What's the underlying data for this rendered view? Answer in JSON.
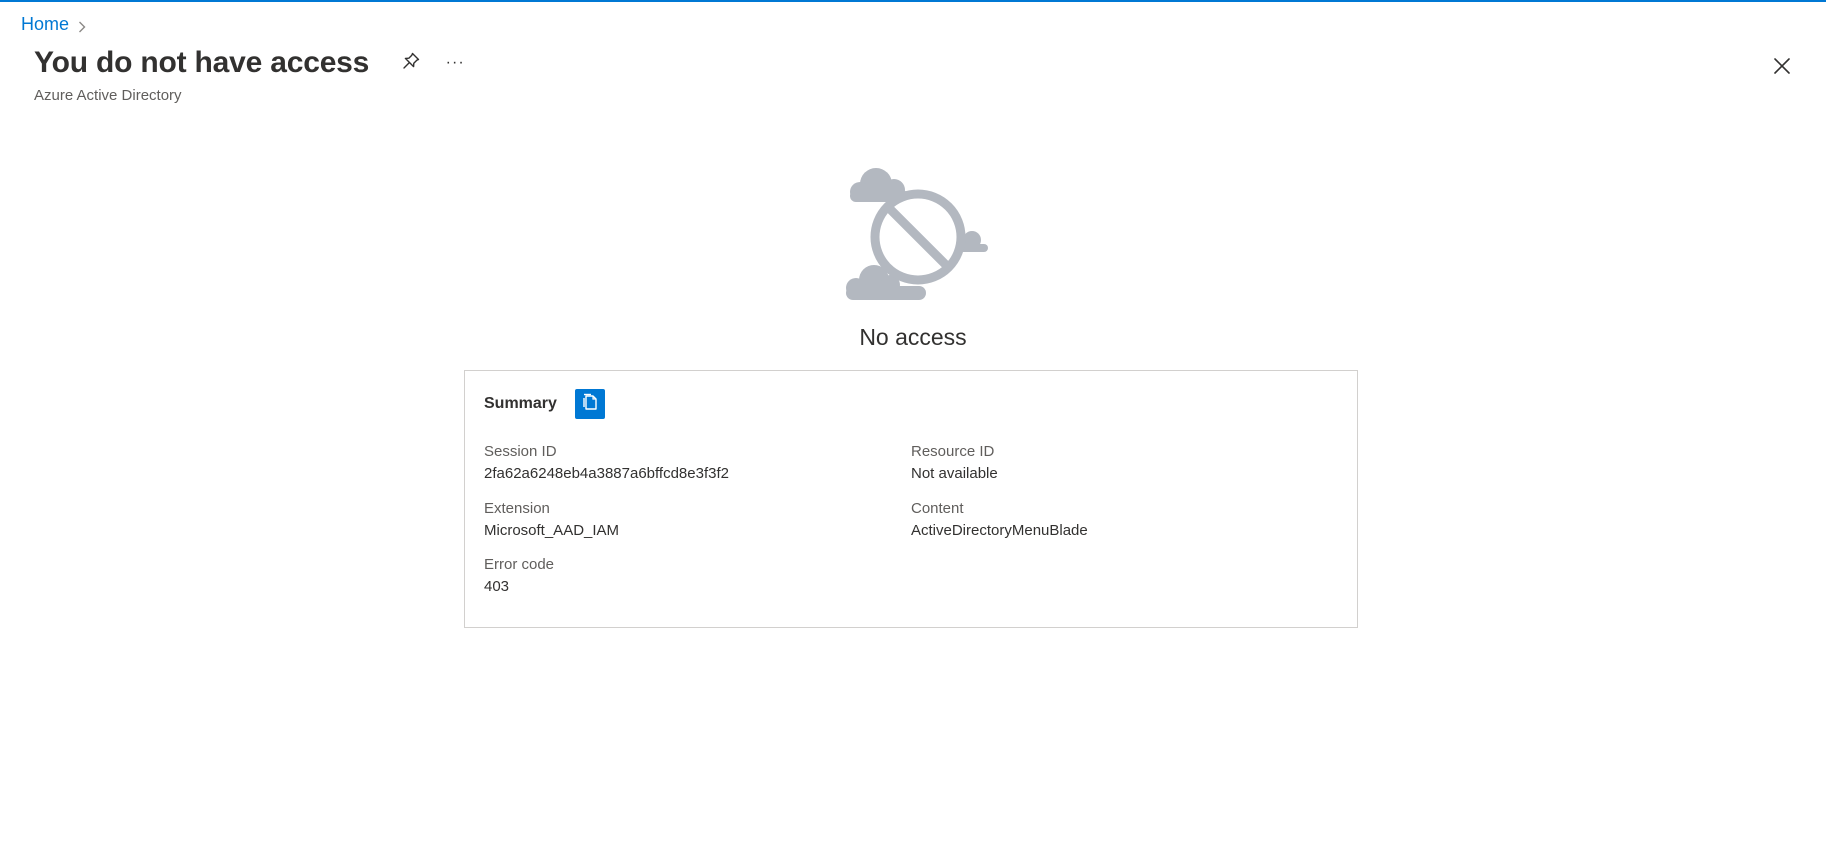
{
  "breadcrumb": {
    "home_label": "Home"
  },
  "header": {
    "title": "You do not have access",
    "subtitle": "Azure Active Directory",
    "more_label": "···"
  },
  "main": {
    "message": "No access"
  },
  "summary": {
    "title": "Summary",
    "fields": {
      "session_id": {
        "label": "Session ID",
        "value": "2fa62a6248eb4a3887a6bffcd8e3f3f2"
      },
      "resource_id": {
        "label": "Resource ID",
        "value": "Not available"
      },
      "extension": {
        "label": "Extension",
        "value": "Microsoft_AAD_IAM"
      },
      "content": {
        "label": "Content",
        "value": "ActiveDirectoryMenuBlade"
      },
      "error_code": {
        "label": "Error code",
        "value": "403"
      }
    }
  },
  "colors": {
    "accent": "#0078d4",
    "text": "#323130",
    "secondary_text": "#605e5c",
    "illustration": "#b3b8c0"
  },
  "icons": {
    "breadcrumb_separator": "chevron-right-icon",
    "pin": "pin-icon",
    "more": "ellipsis-icon",
    "close": "close-icon",
    "copy": "copy-icon",
    "illustration": "no-access-icon"
  }
}
